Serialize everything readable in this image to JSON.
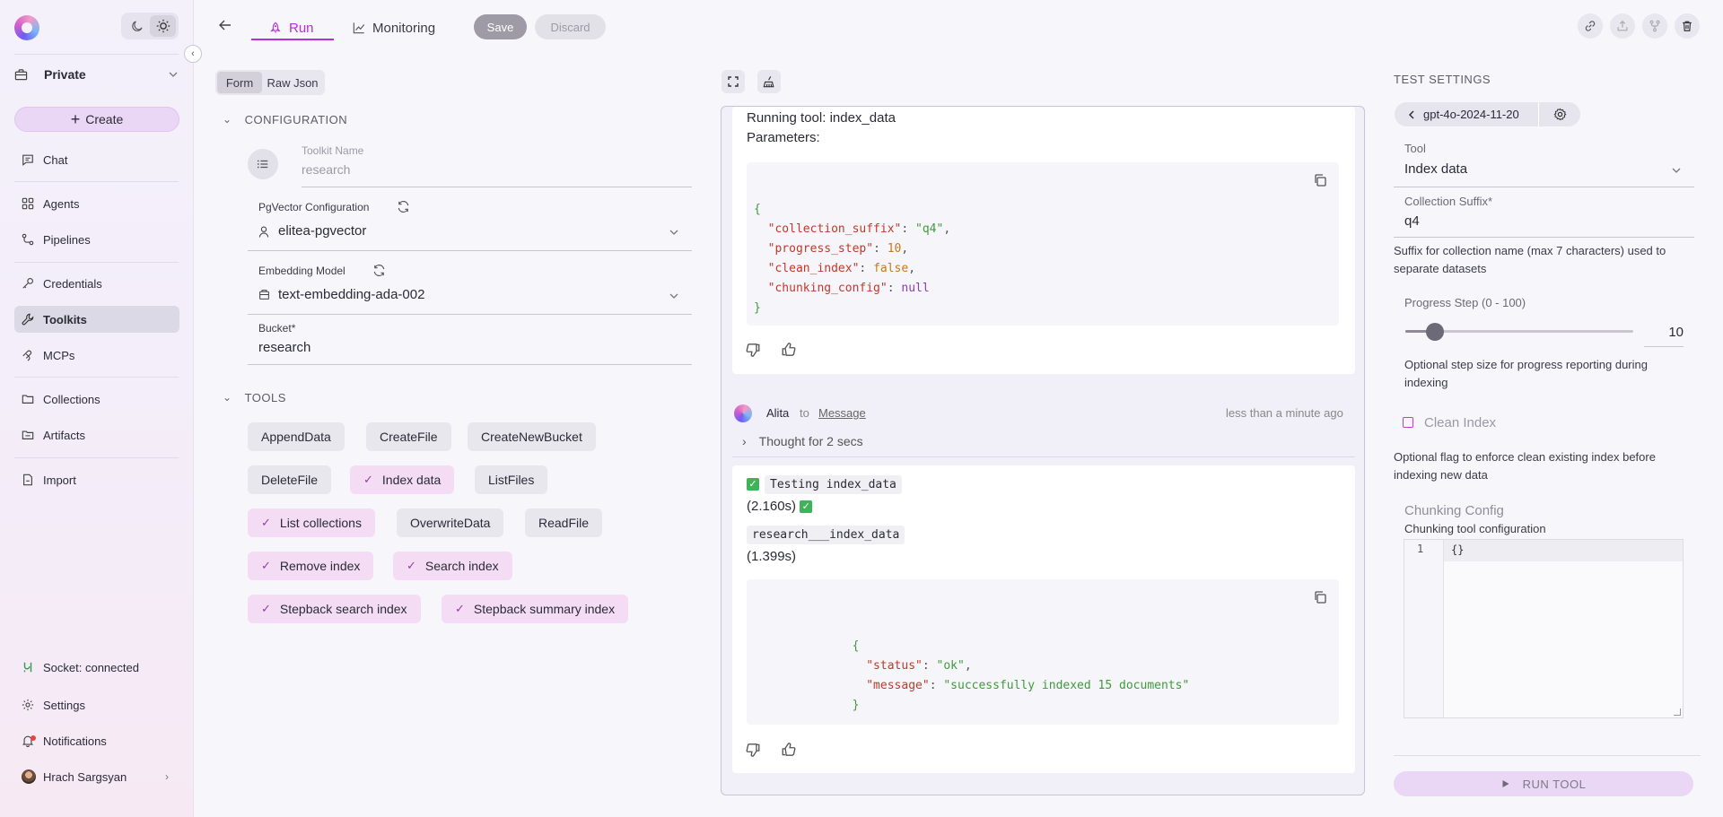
{
  "sidebar": {
    "project": "Private",
    "create_label": "Create",
    "nav": [
      {
        "label": "Chat",
        "icon": "chat-icon"
      },
      {
        "label": "Agents",
        "icon": "agents-icon"
      },
      {
        "label": "Pipelines",
        "icon": "pipelines-icon"
      },
      {
        "label": "Credentials",
        "icon": "key-icon"
      },
      {
        "label": "Toolkits",
        "icon": "wrench-icon"
      },
      {
        "label": "MCPs",
        "icon": "mcp-icon"
      },
      {
        "label": "Collections",
        "icon": "folder-icon"
      },
      {
        "label": "Artifacts",
        "icon": "artifacts-icon"
      },
      {
        "label": "Import",
        "icon": "import-icon"
      }
    ],
    "footer": {
      "socket": "Socket: connected",
      "settings": "Settings",
      "notifications": "Notifications",
      "user": "Hrach Sargsyan"
    },
    "accent_color": "#b42fd4"
  },
  "topbar": {
    "tabs": [
      {
        "label": "Run",
        "active": true
      },
      {
        "label": "Monitoring",
        "active": false
      }
    ],
    "save_label": "Save",
    "discard_label": "Discard"
  },
  "config": {
    "form_toggle": [
      "Form",
      "Raw Json"
    ],
    "configuration_title": "CONFIGURATION",
    "toolkit_name_label": "Toolkit Name",
    "toolkit_name_value": "research",
    "pgvector_label": "PgVector Configuration",
    "pgvector_value": "elitea-pgvector",
    "embedding_label": "Embedding Model",
    "embedding_value": "text-embedding-ada-002",
    "bucket_label": "Bucket",
    "bucket_value": "research",
    "tools_title": "TOOLS",
    "tools": [
      {
        "label": "AppendData",
        "selected": false
      },
      {
        "label": "CreateFile",
        "selected": false
      },
      {
        "label": "CreateNewBucket",
        "selected": false
      },
      {
        "label": "DeleteFile",
        "selected": false
      },
      {
        "label": "Index data",
        "selected": true
      },
      {
        "label": "ListFiles",
        "selected": false
      },
      {
        "label": "List collections",
        "selected": true
      },
      {
        "label": "OverwriteData",
        "selected": false
      },
      {
        "label": "ReadFile",
        "selected": false
      },
      {
        "label": "Remove index",
        "selected": true
      },
      {
        "label": "Search index",
        "selected": true
      },
      {
        "label": "Stepback search index",
        "selected": true
      },
      {
        "label": "Stepback summary index",
        "selected": true
      }
    ]
  },
  "chat": {
    "running_tool": "Running tool: index_data",
    "parameters_label": "Parameters:",
    "sender": "Alita",
    "to_label": "to",
    "to_target": "Message",
    "timestamp": "less than a minute ago",
    "thought": "Thought for 2 secs",
    "testing_label": "Testing index_data",
    "testing_time": "(2.160s)",
    "research_label": "research___index_data",
    "research_time": "(1.399s)"
  },
  "test_settings": {
    "title": "TEST SETTINGS",
    "model": "gpt-4o-2024-11-20",
    "tool_label": "Tool",
    "tool_value": "Index data",
    "collection_suffix_label": "Collection Suffix",
    "collection_suffix_value": "q4",
    "collection_suffix_help": "Suffix for collection name (max 7 characters) used to separate datasets",
    "progress_label": "Progress Step (0 - 100)",
    "progress_value": "10",
    "progress_fraction": 0.1,
    "progress_help": "Optional step size for progress reporting during indexing",
    "clean_index_label": "Clean Index",
    "clean_index_help": "Optional flag to enforce clean existing index before indexing new data",
    "chunking_title": "Chunking Config",
    "chunking_sub": "Chunking tool configuration",
    "editor_line_number": "1",
    "editor_content": "{}",
    "run_label": "RUN TOOL"
  }
}
